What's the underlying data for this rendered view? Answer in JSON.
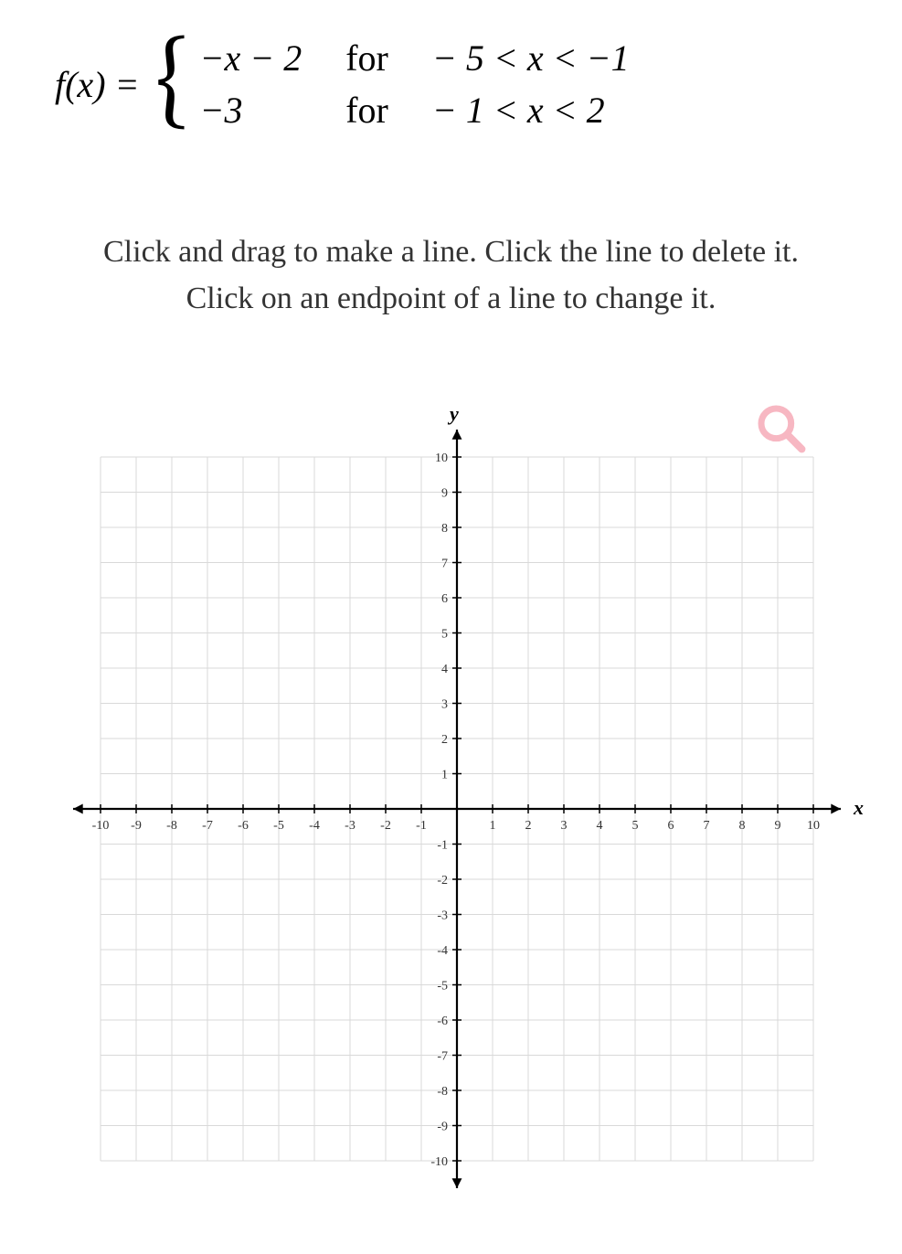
{
  "equation": {
    "lhs": "f(x) =",
    "pieces": [
      {
        "expr": "−x − 2",
        "for": "for",
        "domain": "− 5 < x < −1"
      },
      {
        "expr": "−3",
        "for": "for",
        "domain": "− 1 < x < 2"
      }
    ]
  },
  "instructions": {
    "line1": "Click and drag to make a line. Click the line to delete it.",
    "line2": "Click on an endpoint of a line to change it."
  },
  "chart_data": {
    "type": "line",
    "title": "",
    "xlabel": "x",
    "ylabel": "y",
    "xlim": [
      -10,
      10
    ],
    "ylim": [
      -10,
      10
    ],
    "xticks": [
      -10,
      -9,
      -8,
      -7,
      -6,
      -5,
      -4,
      -3,
      -2,
      -1,
      1,
      2,
      3,
      4,
      5,
      6,
      7,
      8,
      9,
      10
    ],
    "yticks": [
      -10,
      -9,
      -8,
      -7,
      -6,
      -5,
      -4,
      -3,
      -2,
      -1,
      1,
      2,
      3,
      4,
      5,
      6,
      7,
      8,
      9,
      10
    ],
    "series": []
  },
  "icons": {
    "zoom": "search-icon"
  }
}
